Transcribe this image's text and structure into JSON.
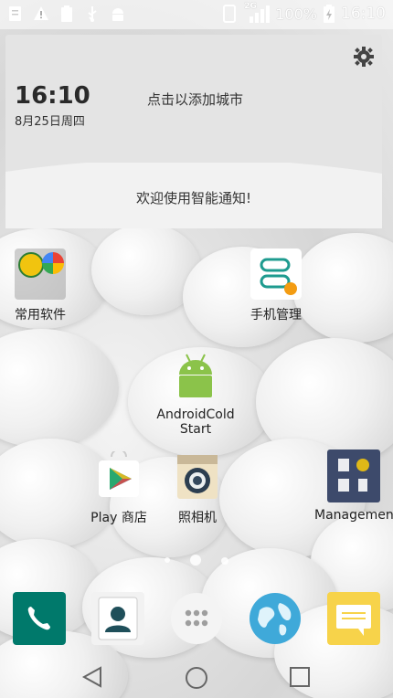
{
  "status_bar": {
    "battery_text": "100%",
    "time": "16:10",
    "network_label": "2G",
    "icons": [
      "notes-icon",
      "warning-icon",
      "battery-full-icon",
      "usb-icon",
      "android-debug-icon"
    ]
  },
  "weather_widget": {
    "time": "16:10",
    "date": "8月25日周四",
    "city_prompt": "点击以添加城市",
    "welcome": "欢迎使用智能通知!"
  },
  "apps": {
    "folder_common": "常用软件",
    "phone_manager": "手机管理",
    "android_cold_start_line1": "AndroidCold",
    "android_cold_start_line2": "Start",
    "play_store": "Play 商店",
    "camera": "照相机",
    "management": "Management"
  },
  "dock": [
    "phone-icon",
    "contacts-icon",
    "app-drawer-icon",
    "browser-globe-icon",
    "messages-icon"
  ],
  "navigation": [
    "back-icon",
    "home-icon",
    "recents-icon"
  ]
}
